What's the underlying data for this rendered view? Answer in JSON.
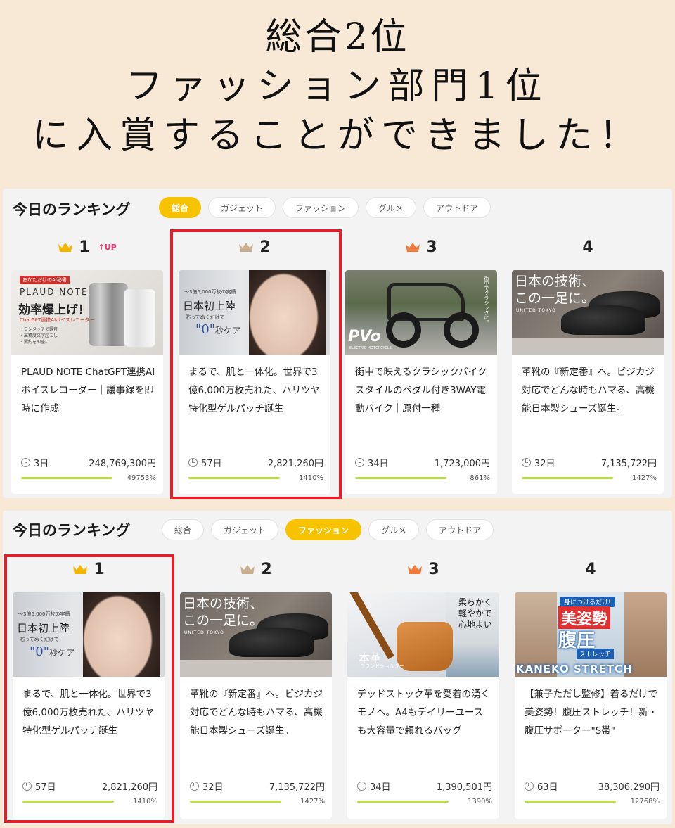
{
  "headline": {
    "line1": "総合2位",
    "line2": "ファッション部門1位",
    "line3": "に入賞することができました！"
  },
  "colors": {
    "accent": "#f7c200",
    "highlight": "#e0202a",
    "progress": "#b8e23a",
    "up": "#ff2a6a"
  },
  "panel1": {
    "title": "今日のランキング",
    "tabs": [
      {
        "label": "総合",
        "active": true
      },
      {
        "label": "ガジェット",
        "active": false
      },
      {
        "label": "ファッション",
        "active": false
      },
      {
        "label": "グルメ",
        "active": false
      },
      {
        "label": "アウトドア",
        "active": false
      }
    ],
    "cards": [
      {
        "rank": "1",
        "crown": "gold-crown-icon",
        "badge": "UP",
        "thumb": {
          "tag": "あなただけのAI秘書",
          "name": "PLAUD NOTE",
          "big": "効率爆上げ！",
          "sub": "ChatGPT連携AIボイスレコーダー",
          "list": [
            "・ワンタッチで録音",
            "・高精度文字起こし",
            "・要約を即座に"
          ]
        },
        "text": "PLAUD NOTE ChatGPT連携AIボイスレコーダー｜議事録を即時に作成",
        "days": "3日",
        "amount": "248,769,300円",
        "percent": "49753%",
        "progress": 1.0
      },
      {
        "rank": "2",
        "crown": "silver-crown-icon",
        "badge": "",
        "thumb": {
          "t1": "〜3億6,000万枚の実績",
          "t2": "日本初上陸",
          "t3": "貼ってぬくだけで",
          "t4": "\"0\"",
          "t5": "秒ケア"
        },
        "text": "まるで、肌と一体化。世界で3億6,000万枚売れた、ハリツヤ特化型ゲルパッチ誕生",
        "days": "57日",
        "amount": "2,821,260円",
        "percent": "1410%",
        "progress": 1.0
      },
      {
        "rank": "3",
        "crown": "bronze-crown-icon",
        "badge": "",
        "thumb": {
          "logo": "PVo",
          "logosub": "ELECTRIC MOTORCYCLE",
          "vtext": "街中でクラシックに。"
        },
        "text": "街中で映えるクラシックバイクスタイルのペダル付き3WAY電動バイク｜原付一種",
        "days": "34日",
        "amount": "1,723,000円",
        "percent": "861%",
        "progress": 1.0
      },
      {
        "rank": "4",
        "crown": "",
        "badge": "",
        "thumb": {
          "title1": "日本の技術、",
          "title2": "この一足に。",
          "brand": "UNITED TOKYO"
        },
        "text": "革靴の『新定番』へ。ビジカジ対応でどんな時もハマる、高機能日本製シューズ誕生。",
        "days": "32日",
        "amount": "7,135,722円",
        "percent": "1427%",
        "progress": 1.0
      }
    ]
  },
  "panel2": {
    "title": "今日のランキング",
    "tabs": [
      {
        "label": "総合",
        "active": false
      },
      {
        "label": "ガジェット",
        "active": false
      },
      {
        "label": "ファッション",
        "active": true
      },
      {
        "label": "グルメ",
        "active": false
      },
      {
        "label": "アウトドア",
        "active": false
      }
    ],
    "cards": [
      {
        "rank": "1",
        "crown": "gold-crown-icon",
        "thumb": {
          "t1": "〜3億6,000万枚の実績",
          "t2": "日本初上陸",
          "t3": "貼ってぬくだけで",
          "t4": "\"0\"",
          "t5": "秒ケア"
        },
        "text": "まるで、肌と一体化。世界で3億6,000万枚売れた、ハリツヤ特化型ゲルパッチ誕生",
        "days": "57日",
        "amount": "2,821,260円",
        "percent": "1410%",
        "progress": 1.0
      },
      {
        "rank": "2",
        "crown": "silver-crown-icon",
        "thumb": {
          "title1": "日本の技術、",
          "title2": "この一足に。",
          "brand": "UNITED TOKYO"
        },
        "text": "革靴の『新定番』へ。ビジカジ対応でどんな時もハマる、高機能日本製シューズ誕生。",
        "days": "32日",
        "amount": "7,135,722円",
        "percent": "1427%",
        "progress": 1.0
      },
      {
        "rank": "3",
        "crown": "bronze-crown-icon",
        "thumb": {
          "t1": "柔らかく",
          "t2": "軽やかで",
          "t3": "心地よい",
          "t4": "本革",
          "t5": "ラウンドショルダー"
        },
        "text": "デッドストック革を愛着の湧くモノへ。A4もデイリーユースも大容量で頼れるバッグ",
        "days": "34日",
        "amount": "1,390,501円",
        "percent": "1390%",
        "progress": 1.0
      },
      {
        "rank": "4",
        "crown": "",
        "thumb": {
          "b1": "身につけるだけ!",
          "b2": "美姿勢",
          "b3": "腹圧",
          "b4": "ストレッチ",
          "b5": "KANEKO STRETCH"
        },
        "text": "【兼子ただし監修】着るだけで美姿勢！腹圧ストレッチ！新・腹圧サポーター\"S帯\"",
        "days": "63日",
        "amount": "38,306,290円",
        "percent": "12768%",
        "progress": 1.0
      }
    ]
  }
}
